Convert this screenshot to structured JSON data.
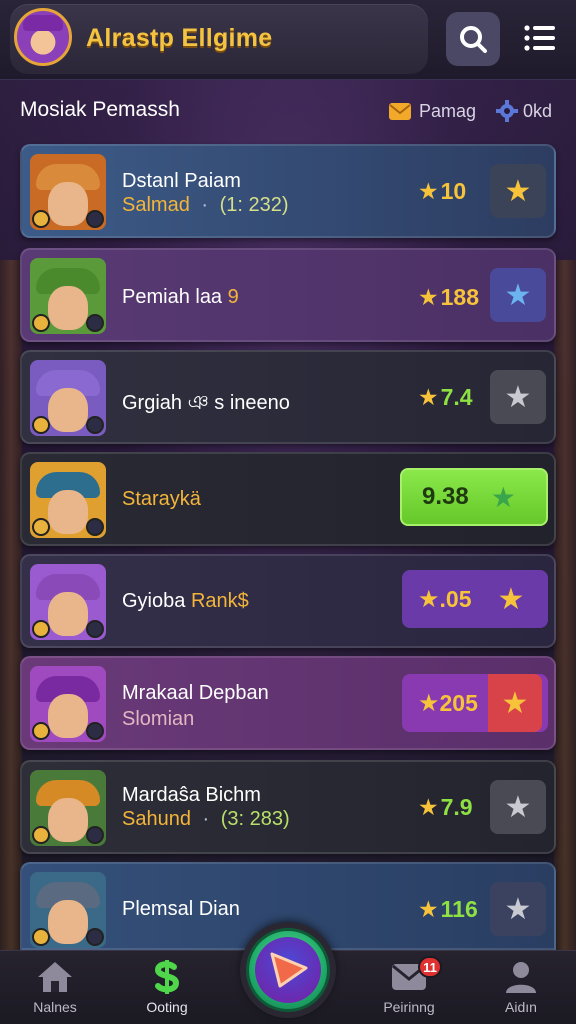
{
  "header": {
    "title": "Alrastp Ellgime"
  },
  "section": {
    "title": "Mosiak Pemassh",
    "filter_a_label": "Pamag",
    "filter_b_label": "0kd"
  },
  "cards": [
    {
      "name": "Dstanl Paiam",
      "sub_name": "Salmad",
      "sub_sep": "·",
      "sub_value": "(1: 232)",
      "score": "10",
      "colors": {
        "bg_from": "#3c5b88",
        "bg_to": "#2d3d61",
        "hat": "#c96a25",
        "star": "#f6c33a",
        "btn": "#3a4357",
        "score_text": "#f6c33a"
      }
    },
    {
      "name": "Pemiah laa",
      "name_suffix": "9",
      "score": "188",
      "colors": {
        "bg_from": "#5a3a74",
        "bg_to": "#4a3064",
        "hat": "#4a8a2c",
        "star": "#6cb4f0",
        "btn": "#4a4a9a",
        "score_text": "#f6c33a"
      }
    },
    {
      "name": "Grgiah",
      "name_suffix": "ঞ s ineeno",
      "score": "7.4",
      "colors": {
        "bg_from": "#303040",
        "bg_to": "#262634",
        "hat": "#7a5cc0",
        "star": "#c9c9d2",
        "btn": "#4a4a54",
        "score_text": "#8fe043"
      }
    },
    {
      "name": "Staraykä",
      "score": "9.38",
      "colors": {
        "bg_from": "#2a2a34",
        "bg_to": "#22222c",
        "hat": "#2d6e8e",
        "star": "#3aa54a",
        "btn": "#7ddd3e",
        "score_text": "#1f3a10"
      }
    },
    {
      "name": "Gyioba",
      "name_suffix": "Rank$",
      "score": ".05",
      "colors": {
        "bg_from": "#34304a",
        "bg_to": "#2a2640",
        "hat": "#8a4ab8",
        "star": "#f6c33a",
        "btn": "#6a3aa8",
        "score_text": "#f6c33a"
      }
    },
    {
      "name": "Mrakaal Depban",
      "sub_name": "Slomian",
      "score": "205",
      "colors": {
        "bg_from": "#6a3a78",
        "bg_to": "#5a2f6a",
        "hat": "#7a2aa0",
        "star": "#f6c33a",
        "btn": "#d8434a",
        "score_text": "#f6c33a"
      }
    },
    {
      "name": "Mardaŝa Bichm",
      "sub_name": "Sahund",
      "sub_sep": "·",
      "sub_value": "(3: 283)",
      "score": "7.9",
      "colors": {
        "bg_from": "#2e2e38",
        "bg_to": "#24242e",
        "hat": "#d58a25",
        "star": "#c9c9d2",
        "btn": "#4a4a54",
        "score_text": "#8fe043"
      }
    },
    {
      "name": "Plemsal Dian",
      "score": "116",
      "colors": {
        "bg_from": "#34507a",
        "bg_to": "#2a3e62",
        "hat": "#5a6a80",
        "star": "#c9c9d2",
        "btn": "#3a4260",
        "score_text": "#8fe043"
      }
    }
  ],
  "nav": {
    "items": [
      {
        "label": "Nalnes",
        "icon": "home-icon"
      },
      {
        "label": "Ooting",
        "icon": "dollar-icon"
      },
      {
        "label": "Peirinng",
        "icon": "mail-icon"
      },
      {
        "label": "Aidın",
        "icon": "user-icon"
      }
    ],
    "notification_count": "11",
    "play_icon": "play-icon"
  }
}
